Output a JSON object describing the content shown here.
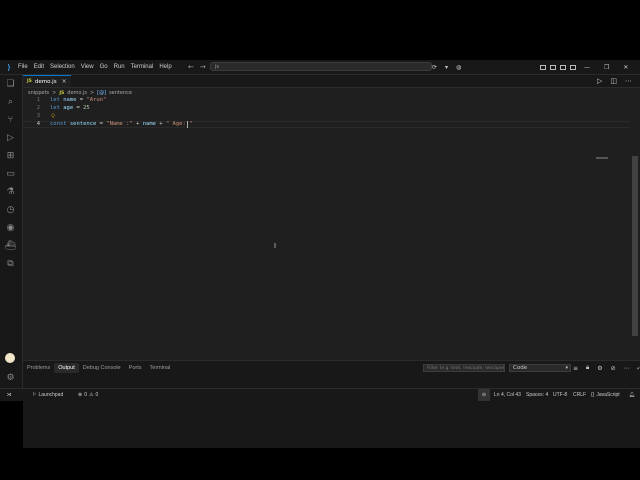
{
  "menu": [
    "File",
    "Edit",
    "Selection",
    "View",
    "Go",
    "Run",
    "Terminal",
    "Help"
  ],
  "command_center": {
    "text": "js"
  },
  "tab": {
    "icon_text": "JS",
    "label": "demo.js",
    "close": "×"
  },
  "breadcrumb": {
    "folder": "snippets",
    "sep": ">",
    "file_icon": "JS",
    "file": "demo.js",
    "symbol_icon": "[@]",
    "symbol": "sentence"
  },
  "code": {
    "line_numbers": [
      "1",
      "2",
      "3",
      "4"
    ],
    "line1": {
      "kw": "let",
      "var": "name",
      "eq": " = ",
      "str": "\"Arun\""
    },
    "line2": {
      "kw": "let",
      "var": "age",
      "eq": " = ",
      "num": "25"
    },
    "line4": {
      "kw": "const",
      "var": "sentence",
      "eq": " = ",
      "s1": "\"Name :\"",
      "op1": " + ",
      "v2": "name",
      "op2": " + ",
      "s2": "\" Age: \""
    }
  },
  "panel": {
    "tabs": [
      "Problems",
      "Output",
      "Debug Console",
      "Ports",
      "Terminal"
    ],
    "active_tab": "Output",
    "filter_placeholder": "Filter (e.g. text, !exclude, \\escape)",
    "channel": "Code"
  },
  "status": {
    "launchpad": "Launchpad",
    "errors": "0",
    "warnings": "0",
    "position": "Ln 4, Col 43",
    "spaces": "Spaces: 4",
    "encoding": "UTF-8",
    "eol": "CRLF",
    "language": "JavaScript"
  },
  "colors": {
    "accent": "#0078d4",
    "background": "#1f1f1f",
    "chrome": "#181818"
  }
}
